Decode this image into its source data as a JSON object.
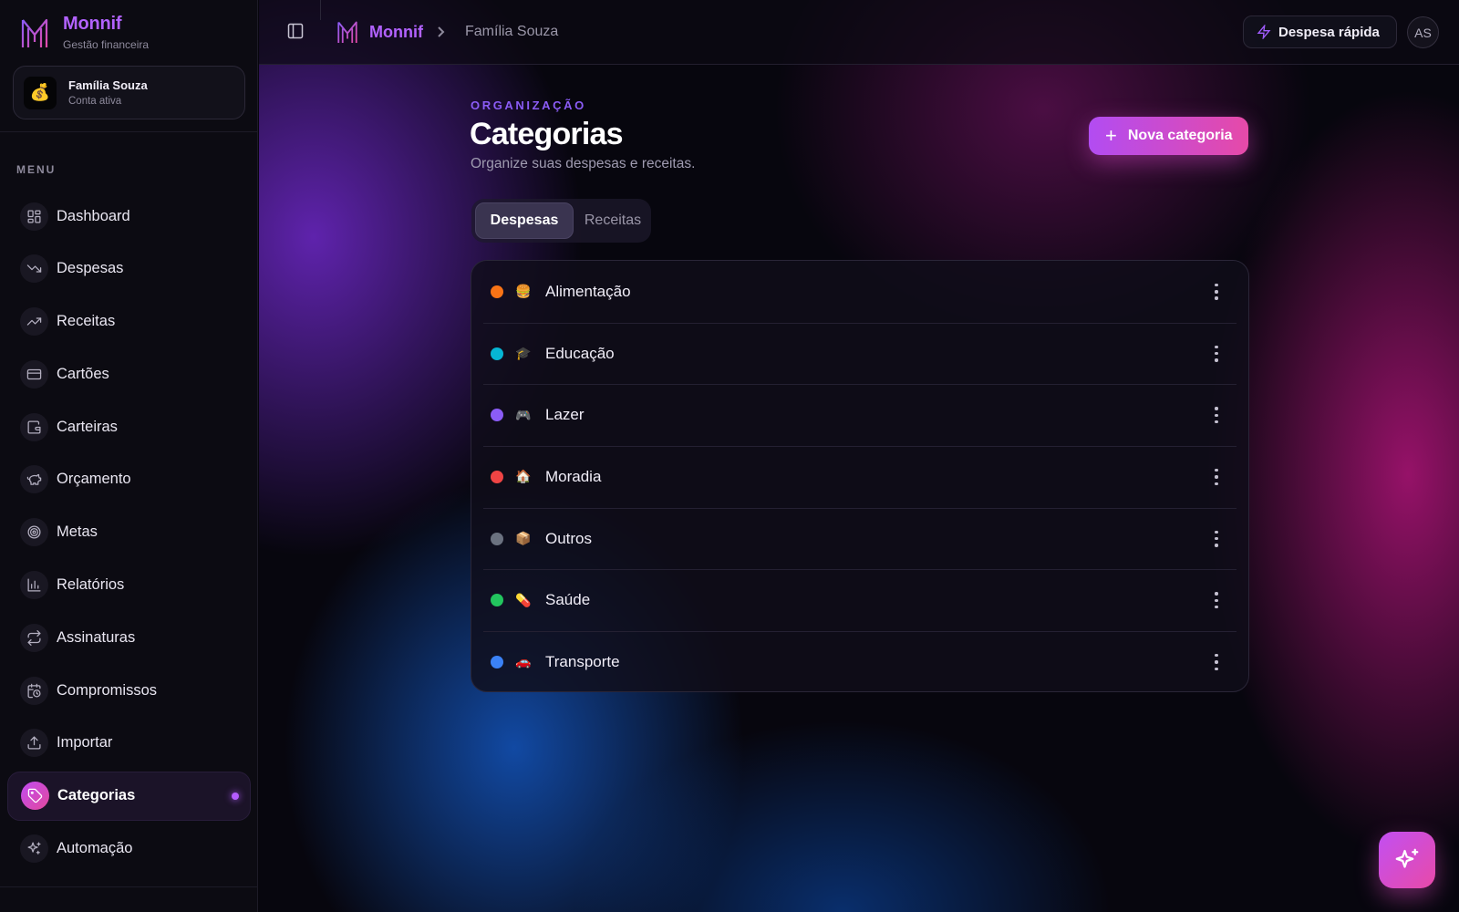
{
  "brand": {
    "name": "Monnif",
    "tagline": "Gestão financeira",
    "icon": "monnif-logo"
  },
  "account": {
    "name": "Família Souza",
    "status": "Conta ativa",
    "icon": "money-bag-icon"
  },
  "menu": {
    "label": "MENU",
    "items": [
      {
        "label": "Dashboard",
        "icon": "dashboard-icon",
        "active": false
      },
      {
        "label": "Despesas",
        "icon": "trending-down-icon",
        "active": false
      },
      {
        "label": "Receitas",
        "icon": "trending-up-icon",
        "active": false
      },
      {
        "label": "Cartões",
        "icon": "credit-card-icon",
        "active": false
      },
      {
        "label": "Carteiras",
        "icon": "wallet-icon",
        "active": false
      },
      {
        "label": "Orçamento",
        "icon": "piggy-bank-icon",
        "active": false
      },
      {
        "label": "Metas",
        "icon": "target-icon",
        "active": false
      },
      {
        "label": "Relatórios",
        "icon": "bar-chart-icon",
        "active": false
      },
      {
        "label": "Assinaturas",
        "icon": "repeat-icon",
        "active": false
      },
      {
        "label": "Compromissos",
        "icon": "calendar-clock-icon",
        "active": false
      },
      {
        "label": "Importar",
        "icon": "upload-icon",
        "active": false
      },
      {
        "label": "Categorias",
        "icon": "tag-icon",
        "active": true
      },
      {
        "label": "Automação",
        "icon": "sparkles-icon",
        "active": false
      }
    ]
  },
  "topbar": {
    "breadcrumb": {
      "brand": "Monnif",
      "current": "Família Souza"
    },
    "quick_expense_label": "Despesa rápida",
    "user_initials": "AS"
  },
  "page": {
    "eyebrow": "ORGANIZAÇÃO",
    "title": "Categorias",
    "subtitle": "Organize suas despesas e receitas.",
    "new_button_label": "Nova categoria",
    "tabs": [
      {
        "label": "Despesas",
        "active": true
      },
      {
        "label": "Receitas",
        "active": false
      }
    ]
  },
  "categories": [
    {
      "name": "Alimentação",
      "emoji": "🍔",
      "color": "#f97316"
    },
    {
      "name": "Educação",
      "emoji": "🎓",
      "color": "#06b6d4"
    },
    {
      "name": "Lazer",
      "emoji": "🎮",
      "color": "#8b5cf6"
    },
    {
      "name": "Moradia",
      "emoji": "🏠",
      "color": "#ef4444"
    },
    {
      "name": "Outros",
      "emoji": "📦",
      "color": "#6b7280"
    },
    {
      "name": "Saúde",
      "emoji": "💊",
      "color": "#22c55e"
    },
    {
      "name": "Transporte",
      "emoji": "🚗",
      "color": "#3b82f6"
    }
  ],
  "theme": {
    "accent": "#b262ff",
    "accent_pink": "#e64aa8",
    "eyebrow": "#8b5cf6"
  }
}
